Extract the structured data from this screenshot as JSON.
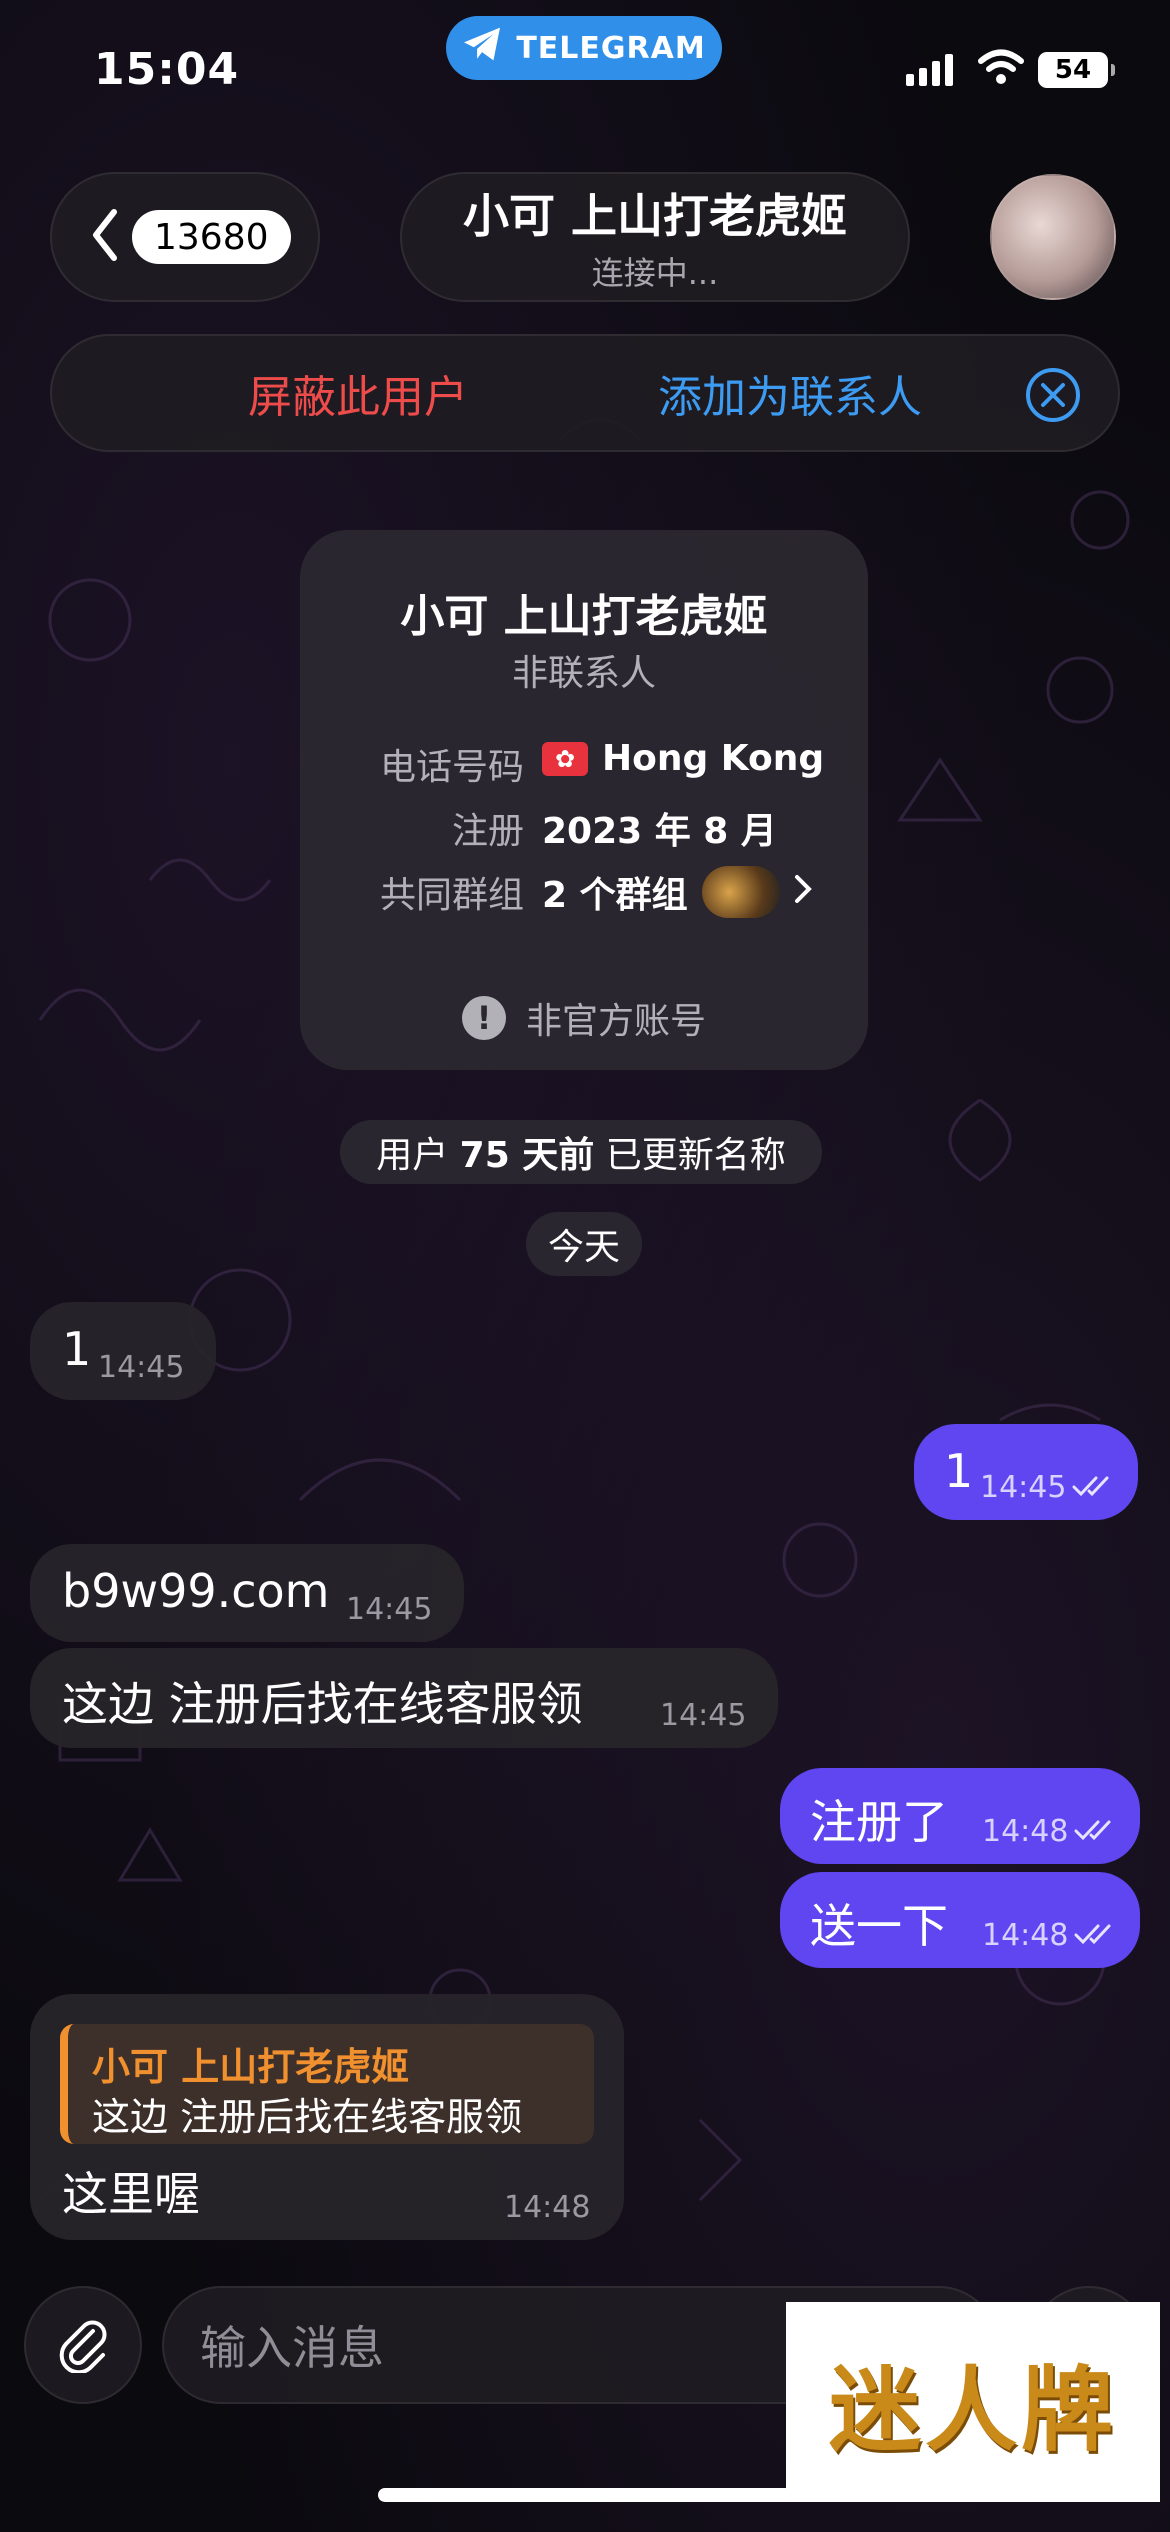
{
  "status_bar": {
    "time": "15:04",
    "app_pill": "TELEGRAM",
    "battery": "54"
  },
  "header": {
    "back_badge": "13680",
    "chat_name": "小可 上山打老虎姬",
    "chat_status": "连接中..."
  },
  "action_bar": {
    "block_label": "屏蔽此用户",
    "add_contact_label": "添加为联系人"
  },
  "info_card": {
    "name": "小可 上山打老虎姬",
    "subtitle": "非联系人",
    "phone_label": "电话号码",
    "phone_value": "Hong Kong",
    "registered_label": "注册",
    "registered_value": "2023 年 8 月",
    "groups_label": "共同群组",
    "groups_value": "2 个群组",
    "official_note": "非官方账号"
  },
  "service_messages": {
    "name_updated_prefix": "用户 ",
    "name_updated_bold": "75 天前",
    "name_updated_suffix": " 已更新名称",
    "date_today": "今天"
  },
  "messages": [
    {
      "dir": "in",
      "text": "1",
      "time": "14:45"
    },
    {
      "dir": "out",
      "text": "1",
      "time": "14:45"
    },
    {
      "dir": "in",
      "text": "b9w99.com",
      "time": "14:45"
    },
    {
      "dir": "in",
      "text": "这边 注册后找在线客服领",
      "time": "14:45"
    },
    {
      "dir": "out",
      "text": "注册了",
      "time": "14:48"
    },
    {
      "dir": "out",
      "text": "送一下",
      "time": "14:48"
    },
    {
      "dir": "in",
      "text": "这里喔",
      "time": "14:48",
      "reply_to": {
        "name": "小可 上山打老虎姬",
        "text": "这边 注册后找在线客服领"
      }
    }
  ],
  "composer": {
    "placeholder": "输入消息"
  },
  "watermark": "迷人牌",
  "colors": {
    "outgoing_bubble": "#6046f0",
    "incoming_bubble": "#26242a",
    "block_red": "#ee4b4b",
    "link_blue": "#3d9bf2",
    "telegram_blue": "#2f8fe9",
    "reply_orange": "#f0902e"
  },
  "icons": {
    "back": "chevron-left-icon",
    "close": "close-circle-icon",
    "attach": "paperclip-icon",
    "read_receipt": "double-check-icon",
    "telegram": "paper-plane-icon",
    "chevron": "chevron-right-icon",
    "official": "exclamation-circle-icon"
  }
}
